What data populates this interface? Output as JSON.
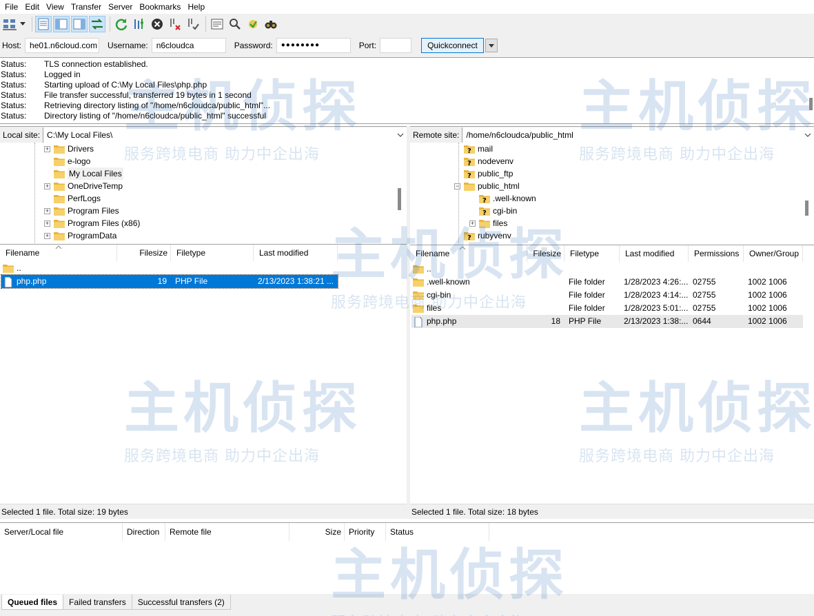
{
  "menu": [
    "File",
    "Edit",
    "View",
    "Transfer",
    "Server",
    "Bookmarks",
    "Help"
  ],
  "toolbar": {
    "icons": [
      "site-manager-icon",
      "toggle-message-log-icon",
      "toggle-local-tree-icon",
      "toggle-remote-tree-icon",
      "toggle-transfer-queue-icon",
      "refresh-icon",
      "process-queue-icon",
      "cancel-icon",
      "disconnect-icon",
      "reconnect-icon",
      "directory-filter-icon",
      "toggle-sync-browsing-icon",
      "compare-directories-icon",
      "search-files-icon"
    ]
  },
  "quickconnect": {
    "host_label": "Host:",
    "host_value": "he01.n6cloud.com",
    "username_label": "Username:",
    "username_value": "n6cloudca",
    "password_label": "Password:",
    "password_value": "●●●●●●●●",
    "port_label": "Port:",
    "port_value": "",
    "button_label": "Quickconnect"
  },
  "log": [
    {
      "k": "Status:",
      "v": "TLS connection established."
    },
    {
      "k": "Status:",
      "v": "Logged in"
    },
    {
      "k": "Status:",
      "v": "Starting upload of C:\\My Local Files\\php.php"
    },
    {
      "k": "Status:",
      "v": "File transfer successful, transferred 19 bytes in 1 second"
    },
    {
      "k": "Status:",
      "v": "Retrieving directory listing of \"/home/n6cloudca/public_html\"..."
    },
    {
      "k": "Status:",
      "v": "Directory listing of \"/home/n6cloudca/public_html\" successful"
    }
  ],
  "local": {
    "site_label": "Local site:",
    "site_path": "C:\\My Local Files\\",
    "tree": [
      {
        "name": "Drivers",
        "expandable": true
      },
      {
        "name": "e-logo",
        "expandable": false
      },
      {
        "name": "My Local Files",
        "expandable": false,
        "selected": true
      },
      {
        "name": "OneDriveTemp",
        "expandable": true
      },
      {
        "name": "PerfLogs",
        "expandable": false
      },
      {
        "name": "Program Files",
        "expandable": true
      },
      {
        "name": "Program Files (x86)",
        "expandable": true
      },
      {
        "name": "ProgramData",
        "expandable": true
      }
    ],
    "columns": [
      "Filename",
      "Filesize",
      "Filetype",
      "Last modified"
    ],
    "files": [
      {
        "name": "..",
        "size": "",
        "type": "",
        "modified": "",
        "kind": "folder"
      },
      {
        "name": "php.php",
        "size": "19",
        "type": "PHP File",
        "modified": "2/13/2023 1:38:21 ...",
        "kind": "file",
        "selected": true
      }
    ],
    "status": "Selected 1 file. Total size: 19 bytes"
  },
  "remote": {
    "site_label": "Remote site:",
    "site_path": "/home/n6cloudca/public_html",
    "tree": [
      {
        "name": "mail",
        "level": 0,
        "expander": "none",
        "icon": "unknown"
      },
      {
        "name": "nodevenv",
        "level": 0,
        "expander": "none",
        "icon": "unknown"
      },
      {
        "name": "public_ftp",
        "level": 0,
        "expander": "none",
        "icon": "unknown"
      },
      {
        "name": "public_html",
        "level": 0,
        "expander": "minus",
        "icon": "folder"
      },
      {
        "name": ".well-known",
        "level": 1,
        "expander": "none",
        "icon": "unknown"
      },
      {
        "name": "cgi-bin",
        "level": 1,
        "expander": "none",
        "icon": "unknown"
      },
      {
        "name": "files",
        "level": 1,
        "expander": "plus",
        "icon": "folder"
      },
      {
        "name": "rubyvenv",
        "level": 0,
        "expander": "none",
        "icon": "unknown"
      }
    ],
    "columns": [
      "Filename",
      "Filesize",
      "Filetype",
      "Last modified",
      "Permissions",
      "Owner/Group"
    ],
    "files": [
      {
        "name": "..",
        "size": "",
        "type": "",
        "modified": "",
        "perms": "",
        "owner": "",
        "kind": "folder"
      },
      {
        "name": ".well-known",
        "size": "",
        "type": "File folder",
        "modified": "1/28/2023 4:26:...",
        "perms": "02755",
        "owner": "1002 1006",
        "kind": "folder"
      },
      {
        "name": "cgi-bin",
        "size": "",
        "type": "File folder",
        "modified": "1/28/2023 4:14:...",
        "perms": "02755",
        "owner": "1002 1006",
        "kind": "folder"
      },
      {
        "name": "files",
        "size": "",
        "type": "File folder",
        "modified": "1/28/2023 5:01:...",
        "perms": "02755",
        "owner": "1002 1006",
        "kind": "folder"
      },
      {
        "name": "php.php",
        "size": "18",
        "type": "PHP File",
        "modified": "2/13/2023 1:38:...",
        "perms": "0644",
        "owner": "1002 1006",
        "kind": "file",
        "selected": true
      }
    ],
    "status": "Selected 1 file. Total size: 18 bytes"
  },
  "queue": {
    "columns": [
      "Server/Local file",
      "Direction",
      "Remote file",
      "Size",
      "Priority",
      "Status"
    ],
    "tabs": [
      "Queued files",
      "Failed transfers",
      "Successful transfers (2)"
    ]
  },
  "watermark": {
    "main": "主机侦探",
    "sub": "服务跨境电商 助力中企出海"
  },
  "colors": {
    "selection": "#0078d7",
    "folder": "#f5c542",
    "toolbar_bg": "#f0f0f0"
  }
}
